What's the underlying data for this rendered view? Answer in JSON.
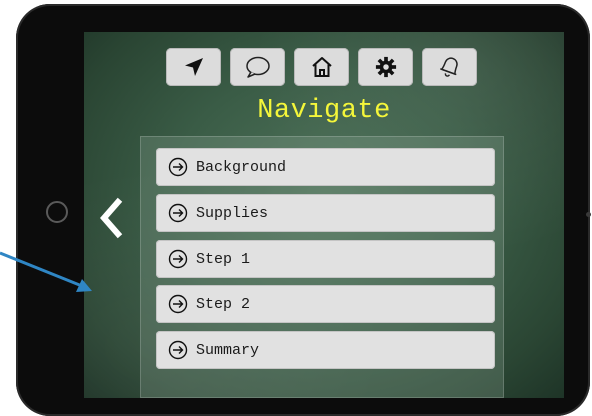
{
  "toolbar": {
    "buttons": [
      {
        "icon": "location-arrow-icon"
      },
      {
        "icon": "speech-bubble-icon"
      },
      {
        "icon": "home-icon"
      },
      {
        "icon": "gear-icon"
      },
      {
        "icon": "bell-icon"
      }
    ]
  },
  "header": {
    "title": "Navigate"
  },
  "menu": {
    "items": [
      {
        "label": "Background"
      },
      {
        "label": "Supplies"
      },
      {
        "label": "Step 1"
      },
      {
        "label": "Step 2"
      },
      {
        "label": "Summary"
      }
    ]
  },
  "colors": {
    "title": "#f4f63a",
    "annotation_arrow": "#2f86c4",
    "button_bg": "#e1e1e1"
  }
}
